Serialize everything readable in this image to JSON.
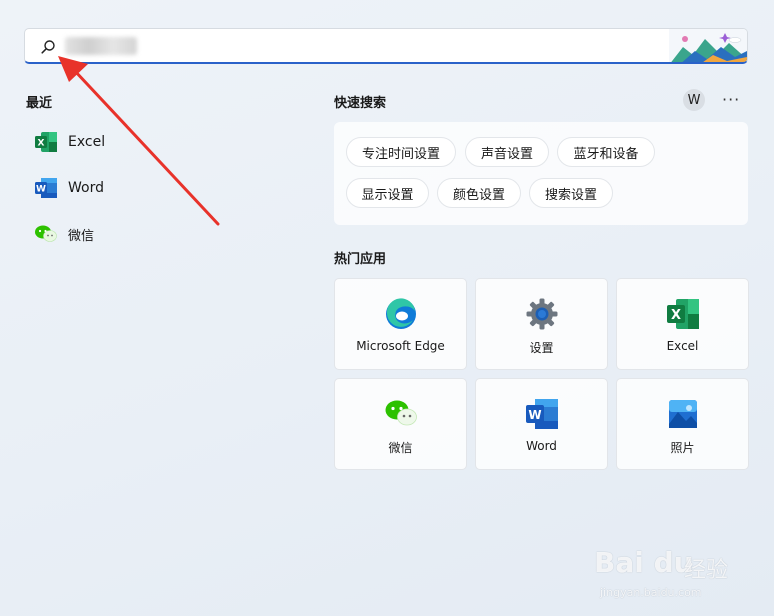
{
  "search": {
    "value": "",
    "placeholder": ""
  },
  "recent": {
    "title": "最近",
    "items": [
      {
        "label": "Excel",
        "icon": "excel-icon"
      },
      {
        "label": "Word",
        "icon": "word-icon"
      },
      {
        "label": "微信",
        "icon": "wechat-icon"
      }
    ]
  },
  "quick_search": {
    "title": "快速搜索",
    "avatar_letter": "W",
    "more": "···",
    "chips": [
      "专注时间设置",
      "声音设置",
      "蓝牙和设备",
      "显示设置",
      "颜色设置",
      "搜索设置"
    ]
  },
  "top_apps": {
    "title": "热门应用",
    "items": [
      {
        "label": "Microsoft Edge",
        "icon": "edge-icon"
      },
      {
        "label": "设置",
        "icon": "settings-gear-icon"
      },
      {
        "label": "Excel",
        "icon": "excel-icon"
      },
      {
        "label": "微信",
        "icon": "wechat-icon"
      },
      {
        "label": "Word",
        "icon": "word-icon"
      },
      {
        "label": "照片",
        "icon": "photos-icon"
      }
    ]
  },
  "watermark": {
    "brand": "Bai du",
    "jingyan": "经验",
    "url": "jingyan.baidu.com"
  },
  "colors": {
    "accent": "#2a62c9",
    "arrow": "#e8322a",
    "excel": "#107c41",
    "word": "#2b579a",
    "wechat": "#2dc100"
  }
}
